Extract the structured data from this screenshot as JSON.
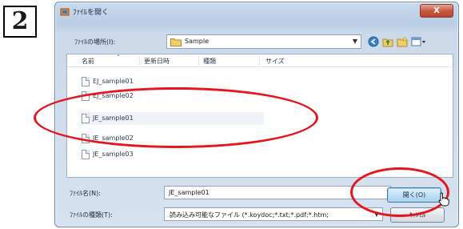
{
  "step": {
    "number": "2"
  },
  "dialog": {
    "title": "ﾌｧｲﾙを開く",
    "close_label": "X",
    "look_in_label": "ﾌｧｲﾙの場所(I):",
    "look_in_value": "Sample",
    "toolbar_icons": [
      "back-icon",
      "up-folder-icon",
      "new-folder-icon",
      "view-menu-icon"
    ]
  },
  "list": {
    "columns": [
      "名前",
      "更新日時",
      "種類",
      "サイズ"
    ],
    "files": [
      {
        "name": "EJ_sample01"
      },
      {
        "name": "EJ_sample02"
      },
      {
        "name": "JE_sample01"
      },
      {
        "name": "JE_sample02"
      },
      {
        "name": "JE_sample03"
      }
    ],
    "selected_index": 2
  },
  "footer": {
    "filename_label": "ﾌｧｲﾙ名(N):",
    "filename_value": "JE_sample01",
    "filetype_label": "ﾌｧｲﾙの種類(T):",
    "filetype_value": "読み込み可能なファイル (*.koydoc;*.txt;*.pdf;*.htm;",
    "open_label": "開く(O)",
    "cancel_label": "ｷｬﾝｾﾙ"
  },
  "colors": {
    "annotation": "#e8141b",
    "dialog_frame": "#b9cde4"
  }
}
